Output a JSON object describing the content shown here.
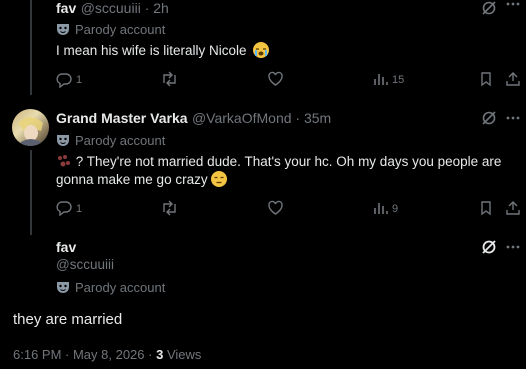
{
  "tweet1": {
    "name": "fav",
    "handle": "@sccuuiii",
    "time": "2h",
    "parody": "Parody account",
    "text": "I mean his wife is literally Nicole",
    "replies": "1",
    "views": "15"
  },
  "tweet2": {
    "name": "Grand Master Varka",
    "handle": "@VarkaOfMond",
    "time": "35m",
    "parody": "Parody account",
    "text": "? They're not married dude. That's your hc. Oh my days you people are gonna make me go crazy",
    "replies": "1",
    "views": "9"
  },
  "main": {
    "name": "fav",
    "handle": "@sccuuiii",
    "parody": "Parody account",
    "text": "they are married",
    "timestamp": "6:16 PM · May 8, 2026 · ",
    "views_count": "3",
    "views_label": "Views"
  },
  "sep": " · "
}
